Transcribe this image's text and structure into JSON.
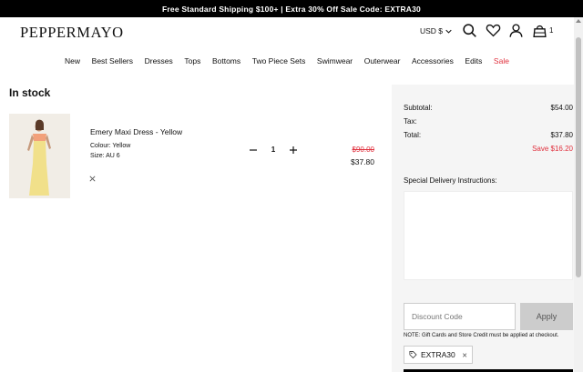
{
  "promo": {
    "text": "Free Standard Shipping $100+ | Extra 30% Off Sale Code: EXTRA30"
  },
  "header": {
    "logo": "PEPPERMAYO",
    "currency": "USD $",
    "cart_count": "1",
    "icons": [
      "search-icon",
      "heart-icon",
      "user-icon",
      "bag-icon"
    ]
  },
  "nav": {
    "items": [
      "New",
      "Best Sellers",
      "Dresses",
      "Tops",
      "Bottoms",
      "Two Piece Sets",
      "Swimwear",
      "Outerwear",
      "Accessories",
      "Edits",
      "Sale"
    ],
    "sale_color": "#e0303d"
  },
  "cart": {
    "section_title": "In stock",
    "item": {
      "name": "Emery Maxi Dress - Yellow",
      "colour": "Colour: Yellow",
      "size": "Size: AU 6",
      "quantity": "1",
      "price_original": "$90.00",
      "price_sale": "$37.80"
    }
  },
  "summary": {
    "subtotal_label": "Subtotal:",
    "subtotal_value": "$54.00",
    "tax_label": "Tax:",
    "total_label": "Total:",
    "total_value": "$37.80",
    "save_text": "Save $16.20",
    "instructions_label": "Special Delivery Instructions:",
    "discount_placeholder": "Discount Code",
    "apply_label": "Apply",
    "note": "NOTE: Gift Cards and Store Credit must be applied at checkout.",
    "applied_code": "EXTRA30"
  }
}
